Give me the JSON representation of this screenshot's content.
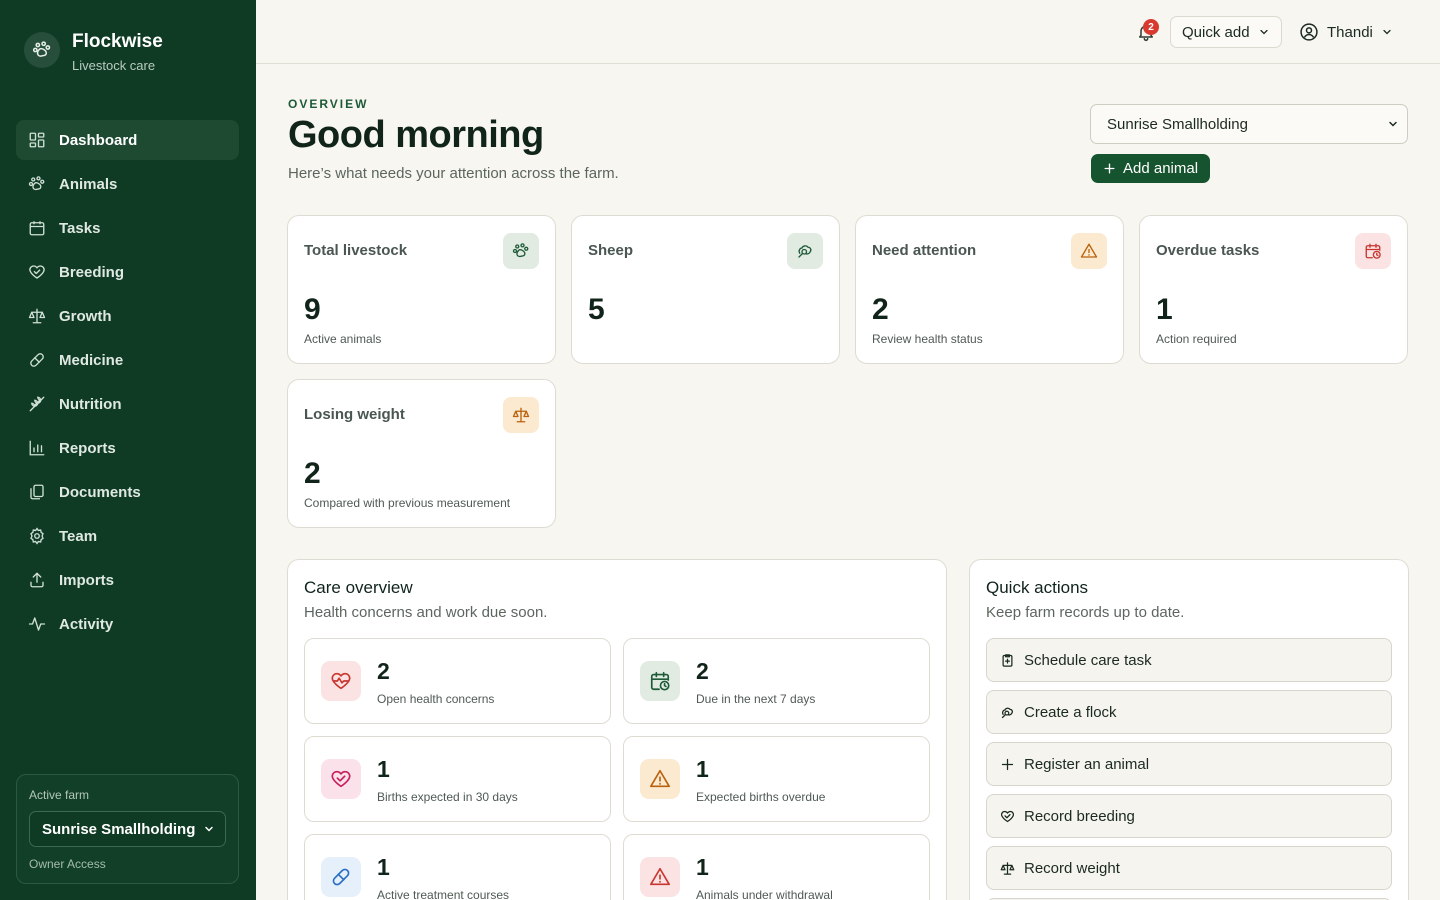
{
  "brand": {
    "name": "Flockwise",
    "tagline": "Livestock care",
    "icon": "paw-icon"
  },
  "nav": [
    {
      "label": "Dashboard",
      "icon": "dashboard-icon",
      "active": true
    },
    {
      "label": "Animals",
      "icon": "paw-icon"
    },
    {
      "label": "Tasks",
      "icon": "calendar-icon"
    },
    {
      "label": "Breeding",
      "icon": "heart-icon"
    },
    {
      "label": "Growth",
      "icon": "scale-icon"
    },
    {
      "label": "Medicine",
      "icon": "pill-icon"
    },
    {
      "label": "Nutrition",
      "icon": "wheat-icon"
    },
    {
      "label": "Reports",
      "icon": "bar-chart-icon"
    },
    {
      "label": "Documents",
      "icon": "documents-icon"
    },
    {
      "label": "Team",
      "icon": "gear-icon"
    },
    {
      "label": "Imports",
      "icon": "upload-icon"
    },
    {
      "label": "Activity",
      "icon": "activity-icon"
    }
  ],
  "farm_box": {
    "label": "Active farm",
    "selected": "Sunrise Smallholding",
    "access": "Owner Access"
  },
  "topbar": {
    "notification_count": "2",
    "quick_add_label": "Quick add",
    "user_name": "Thandi"
  },
  "header": {
    "overline": "OVERVIEW",
    "title": "Good morning",
    "subtitle": "Here’s what needs your attention across the farm.",
    "farm_select": "Sunrise Smallholding",
    "add_animal_label": "Add animal"
  },
  "stats": [
    {
      "label": "Total livestock",
      "value": "9",
      "note": "Active animals",
      "icon": "paw-icon",
      "tone": "green"
    },
    {
      "label": "Sheep",
      "value": "5",
      "note": "",
      "icon": "sheep-icon",
      "tone": "green"
    },
    {
      "label": "Need attention",
      "value": "2",
      "note": "Review health status",
      "icon": "warning-icon",
      "tone": "amber"
    },
    {
      "label": "Overdue tasks",
      "value": "1",
      "note": "Action required",
      "icon": "calendar-clock-icon",
      "tone": "red"
    },
    {
      "label": "Losing weight",
      "value": "2",
      "note": "Compared with previous measurement",
      "icon": "scale-icon",
      "tone": "amber"
    }
  ],
  "care": {
    "title": "Care overview",
    "subtitle": "Health concerns and work due soon.",
    "items": [
      {
        "value": "2",
        "label": "Open health concerns",
        "icon": "heart-pulse-icon",
        "tone": "red"
      },
      {
        "value": "2",
        "label": "Due in the next 7 days",
        "icon": "calendar-clock-icon",
        "tone": "green"
      },
      {
        "value": "1",
        "label": "Births expected in 30 days",
        "icon": "heart-icon",
        "tone": "pink"
      },
      {
        "value": "1",
        "label": "Expected births overdue",
        "icon": "warning-icon",
        "tone": "amber"
      },
      {
        "value": "1",
        "label": "Active treatment courses",
        "icon": "pill-icon",
        "tone": "blue"
      },
      {
        "value": "1",
        "label": "Animals under withdrawal",
        "icon": "warning-icon",
        "tone": "red"
      }
    ]
  },
  "quick_actions": {
    "title": "Quick actions",
    "subtitle": "Keep farm records up to date.",
    "items": [
      {
        "label": "Schedule care task",
        "icon": "clipboard-icon"
      },
      {
        "label": "Create a flock",
        "icon": "sheep-icon"
      },
      {
        "label": "Register an animal",
        "icon": "plus-icon"
      },
      {
        "label": "Record breeding",
        "icon": "heart-icon"
      },
      {
        "label": "Record weight",
        "icon": "scale-icon"
      }
    ]
  }
}
